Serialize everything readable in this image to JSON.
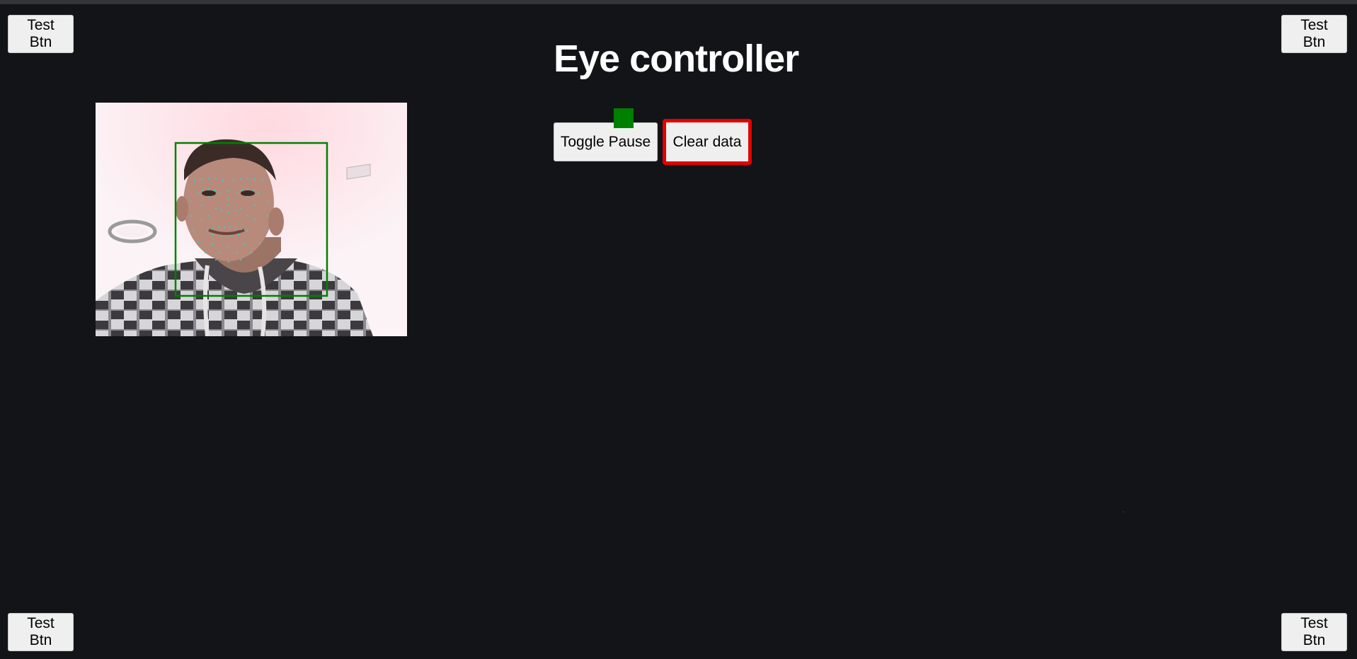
{
  "page": {
    "title": "Eye controller"
  },
  "corner_buttons": {
    "top_left_label": "Test Btn",
    "top_right_label": "Test Btn",
    "bottom_left_label": "Test Btn",
    "bottom_right_label": "Test Btn"
  },
  "controls": {
    "toggle_pause_label": "Toggle Pause",
    "clear_data_label": "Clear data",
    "status_indicator_color": "#008000",
    "clear_highlight_color": "#e40000"
  },
  "webcam": {
    "face_box_color": "#008000",
    "landmark_color": "#2fd6c8"
  },
  "colors": {
    "background": "#131417",
    "title": "#ffffff",
    "button_bg": "#efefef"
  }
}
